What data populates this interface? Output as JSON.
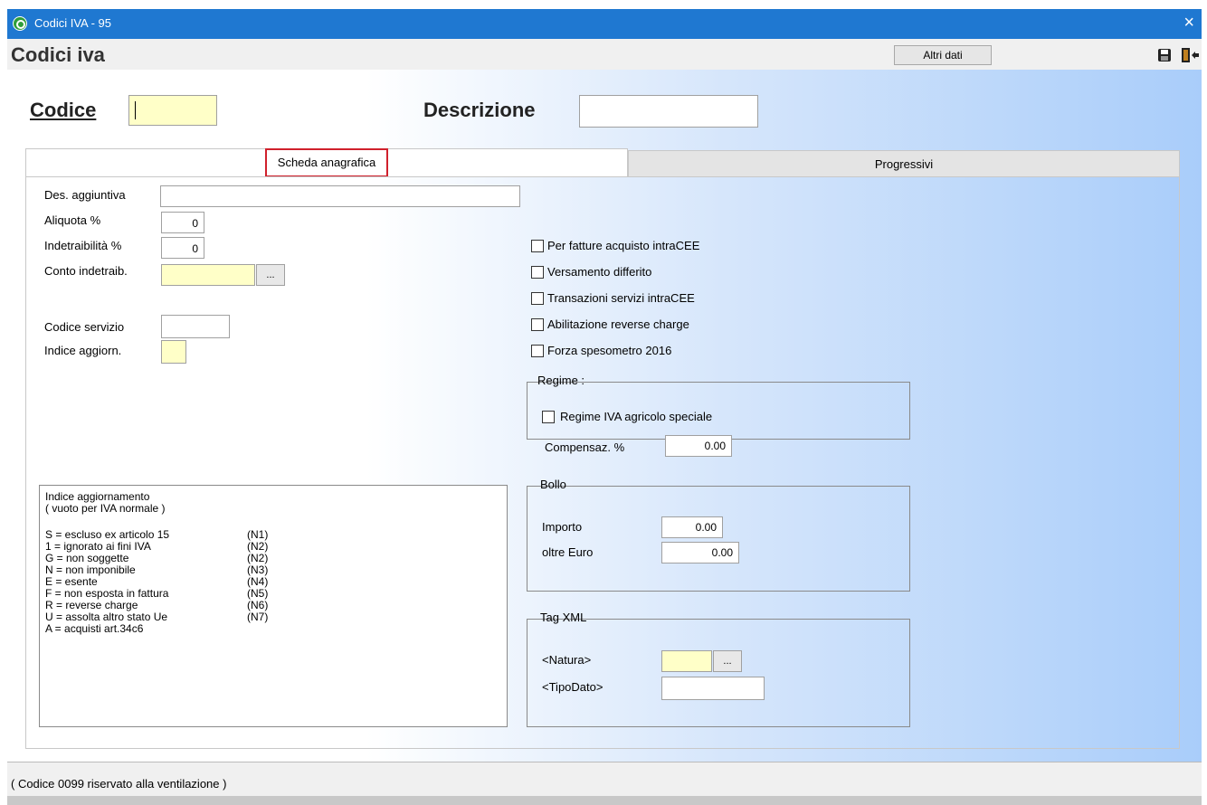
{
  "window": {
    "title": "Codici IVA - 95",
    "close_glyph": "×"
  },
  "header": {
    "title": "Codici iva",
    "altri_dati_label": "Altri dati",
    "icons": [
      "save-icon",
      "exit-icon"
    ]
  },
  "top": {
    "codice_label": "Codice",
    "descrizione_label": "Descrizione",
    "codice_value": "",
    "descrizione_value": ""
  },
  "tabs": [
    {
      "label": "Scheda anagrafica",
      "active": true
    },
    {
      "label": "Progressivi",
      "active": false
    }
  ],
  "form": {
    "des_aggiuntiva_label": "Des. aggiuntiva",
    "aliquota_label": "Aliquota %",
    "aliquota_value": "0",
    "indetraibilita_label": "Indetraibilità %",
    "indetraibilita_value": "0",
    "conto_indetraib_label": "Conto indetraib.",
    "ellipsis": "...",
    "codice_servizio_label": "Codice servizio",
    "indice_aggiorn_label": "Indice aggiorn."
  },
  "checkboxes": [
    {
      "label": "Per fatture acquisto intraCEE",
      "checked": false
    },
    {
      "label": "Versamento differito",
      "checked": false
    },
    {
      "label": "Transazioni servizi intraCEE",
      "checked": false
    },
    {
      "label": "Abilitazione reverse charge",
      "checked": false
    },
    {
      "label": "Forza spesometro 2016",
      "checked": false
    }
  ],
  "regime": {
    "legend": "Regime :",
    "agricolo_label": "Regime IVA agricolo speciale",
    "compensaz_label": "Compensaz. %",
    "compensaz_value": "0.00"
  },
  "bollo": {
    "legend": "Bollo",
    "importo_label": "Importo",
    "importo_value": "0.00",
    "oltre_label": "oltre Euro",
    "oltre_value": "0.00"
  },
  "tagxml": {
    "legend": "Tag XML",
    "natura_label": "<Natura>",
    "tipodato_label": "<TipoDato>"
  },
  "legend_box": {
    "title1": "Indice aggiornamento",
    "title2": "( vuoto per IVA normale )",
    "rows": [
      {
        "text": "S   = escluso ex articolo 15",
        "code": "(N1)"
      },
      {
        "text": "1   = ignorato ai fini IVA",
        "code": "(N2)"
      },
      {
        "text": "G   = non soggette",
        "code": "(N2)"
      },
      {
        "text": "N   = non imponibile",
        "code": "(N3)"
      },
      {
        "text": "E   = esente",
        "code": "(N4)"
      },
      {
        "text": "F   = non esposta in fattura",
        "code": "(N5)"
      },
      {
        "text": "R   = reverse charge",
        "code": "(N6)"
      },
      {
        "text": "U   = assolta altro stato Ue",
        "code": "(N7)"
      },
      {
        "text": "A   = acquisti art.34c6",
        "code": ""
      }
    ]
  },
  "status": {
    "text": "( Codice 0099 riservato alla ventilazione )"
  }
}
